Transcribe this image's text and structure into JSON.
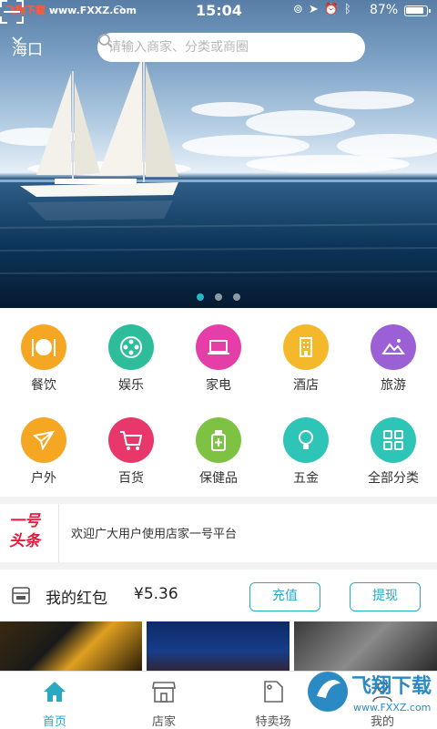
{
  "status_bar": {
    "left_brand": "飞翔下载",
    "left_url": "www.FXXZ.com",
    "time": "15:04",
    "battery": "87%"
  },
  "header": {
    "city": "海口",
    "search_placeholder": "请输入商家、分类或商圈"
  },
  "carousel": {
    "pages": 3,
    "active": 0
  },
  "categories": [
    {
      "label": "餐饮",
      "color": "#f5a623",
      "icon": "dining-icon"
    },
    {
      "label": "娱乐",
      "color": "#2ebd9b",
      "icon": "film-reel-icon"
    },
    {
      "label": "家电",
      "color": "#e53ea8",
      "icon": "laptop-icon"
    },
    {
      "label": "酒店",
      "color": "#f5b82a",
      "icon": "hotel-icon"
    },
    {
      "label": "旅游",
      "color": "#9b5fd6",
      "icon": "landscape-icon"
    },
    {
      "label": "户外",
      "color": "#f5a623",
      "icon": "paper-plane-icon"
    },
    {
      "label": "百货",
      "color": "#e8376a",
      "icon": "cart-icon"
    },
    {
      "label": "保健品",
      "color": "#7dc243",
      "icon": "medicine-bottle-icon"
    },
    {
      "label": "五金",
      "color": "#2ec4b6",
      "icon": "bulb-icon"
    },
    {
      "label": "全部分类",
      "color": "#2ec4b6",
      "icon": "grid-icon"
    }
  ],
  "news": {
    "logo_line1": "一号",
    "logo_line2": "头条",
    "text": "欢迎广大用户使用店家一号平台"
  },
  "wallet": {
    "title": "我的红包",
    "amount": "¥5.36",
    "recharge": "充值",
    "withdraw": "提现"
  },
  "tabs": [
    {
      "label": "首页",
      "icon": "home-icon",
      "active": true
    },
    {
      "label": "店家",
      "icon": "shop-icon",
      "active": false
    },
    {
      "label": "特卖场",
      "icon": "sale-tag-icon",
      "active": false
    },
    {
      "label": "我的",
      "icon": "profile-icon",
      "active": false
    }
  ],
  "watermark": {
    "text": "飞翔下载",
    "url": "www.FXXZ.com"
  },
  "colors": {
    "accent": "#29a9c2",
    "news_red": "#e8193e"
  }
}
